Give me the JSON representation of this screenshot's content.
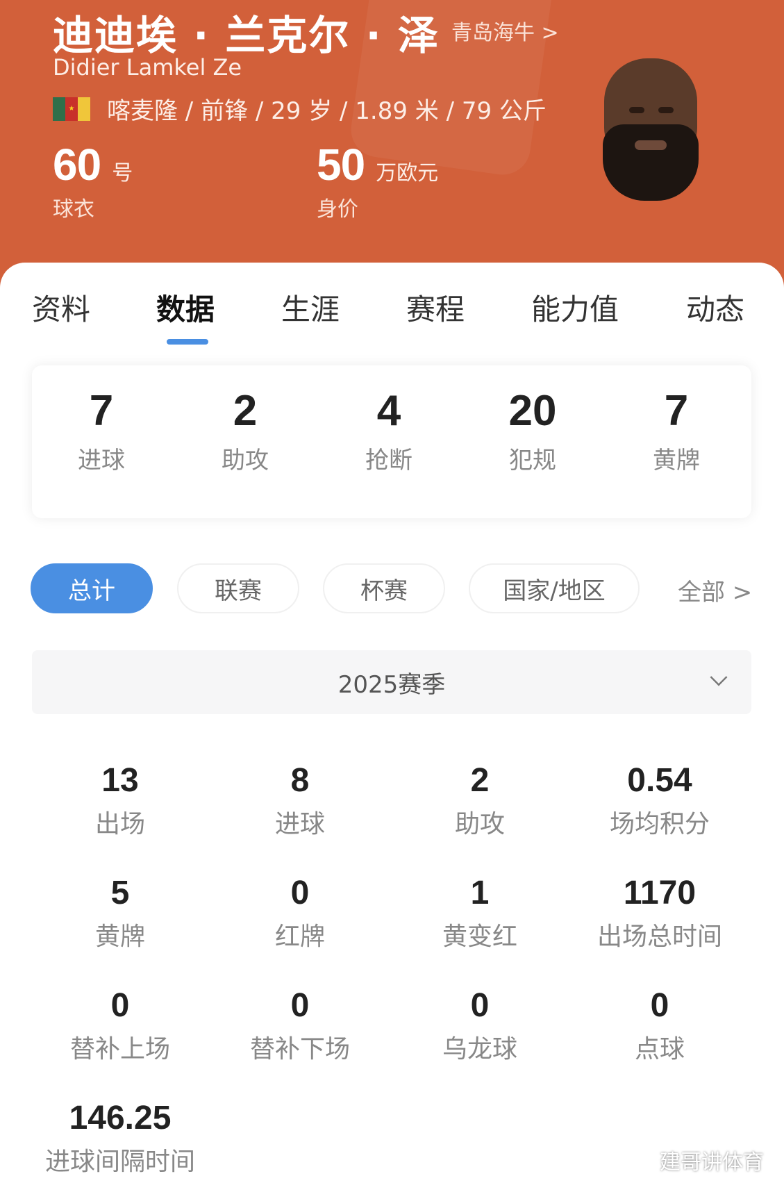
{
  "header": {
    "name_cn": "迪迪埃 · 兰克尔 · 泽",
    "team_link": "青岛海牛 >",
    "name_en": "Didier Lamkel Ze",
    "profile_line": "喀麦隆 / 前锋 / 29 岁 / 1.89 米 / 79 公斤",
    "jersey_number": "60",
    "jersey_unit": "号",
    "jersey_label": "球衣",
    "market_value": "50",
    "market_value_unit": "万欧元",
    "market_value_label": "身价",
    "flag_colors": [
      "#2f6f4a",
      "#c8302a",
      "#f0c63a"
    ]
  },
  "tabs": [
    "资料",
    "数据",
    "生涯",
    "赛程",
    "能力值",
    "动态"
  ],
  "active_tab": "数据",
  "summary": [
    {
      "value": "7",
      "label": "进球"
    },
    {
      "value": "2",
      "label": "助攻"
    },
    {
      "value": "4",
      "label": "抢断"
    },
    {
      "value": "20",
      "label": "犯规"
    },
    {
      "value": "7",
      "label": "黄牌"
    }
  ],
  "filters": [
    "总计",
    "联赛",
    "杯赛",
    "国家/地区"
  ],
  "filter_all": "全部 >",
  "season": "2025赛季",
  "stats": [
    {
      "value": "13",
      "label": "出场"
    },
    {
      "value": "8",
      "label": "进球"
    },
    {
      "value": "2",
      "label": "助攻"
    },
    {
      "value": "0.54",
      "label": "场均积分"
    },
    {
      "value": "5",
      "label": "黄牌"
    },
    {
      "value": "0",
      "label": "红牌"
    },
    {
      "value": "1",
      "label": "黄变红"
    },
    {
      "value": "1170",
      "label": "出场总时间"
    },
    {
      "value": "0",
      "label": "替补上场"
    },
    {
      "value": "0",
      "label": "替补下场"
    },
    {
      "value": "0",
      "label": "乌龙球"
    },
    {
      "value": "0",
      "label": "点球"
    },
    {
      "value": "146.25",
      "label": "进球间隔时间"
    }
  ],
  "watermark": "建哥讲体育",
  "colors": {
    "header_bg": "#d2603a",
    "accent": "#4a8fe2"
  }
}
